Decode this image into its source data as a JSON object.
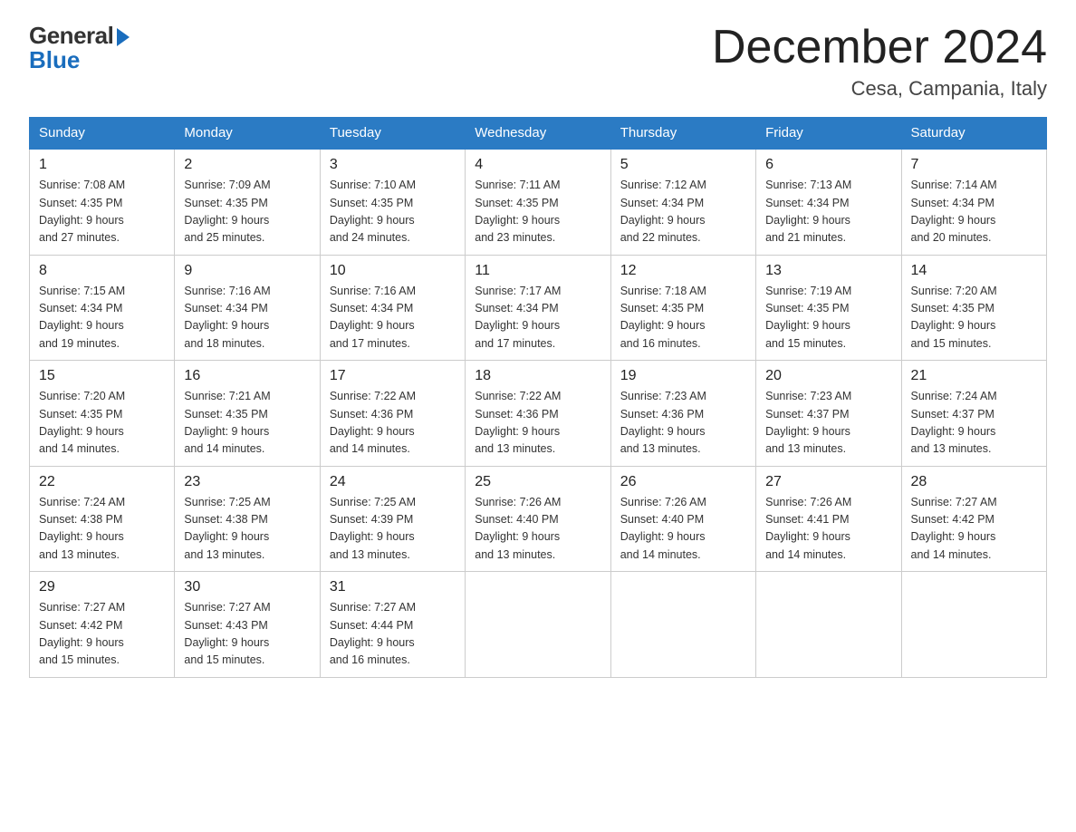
{
  "header": {
    "logo_general": "General",
    "logo_blue": "Blue",
    "month_title": "December 2024",
    "location": "Cesa, Campania, Italy"
  },
  "days_of_week": [
    "Sunday",
    "Monday",
    "Tuesday",
    "Wednesday",
    "Thursday",
    "Friday",
    "Saturday"
  ],
  "weeks": [
    [
      {
        "day": "1",
        "sunrise": "7:08 AM",
        "sunset": "4:35 PM",
        "daylight": "9 hours and 27 minutes."
      },
      {
        "day": "2",
        "sunrise": "7:09 AM",
        "sunset": "4:35 PM",
        "daylight": "9 hours and 25 minutes."
      },
      {
        "day": "3",
        "sunrise": "7:10 AM",
        "sunset": "4:35 PM",
        "daylight": "9 hours and 24 minutes."
      },
      {
        "day": "4",
        "sunrise": "7:11 AM",
        "sunset": "4:35 PM",
        "daylight": "9 hours and 23 minutes."
      },
      {
        "day": "5",
        "sunrise": "7:12 AM",
        "sunset": "4:34 PM",
        "daylight": "9 hours and 22 minutes."
      },
      {
        "day": "6",
        "sunrise": "7:13 AM",
        "sunset": "4:34 PM",
        "daylight": "9 hours and 21 minutes."
      },
      {
        "day": "7",
        "sunrise": "7:14 AM",
        "sunset": "4:34 PM",
        "daylight": "9 hours and 20 minutes."
      }
    ],
    [
      {
        "day": "8",
        "sunrise": "7:15 AM",
        "sunset": "4:34 PM",
        "daylight": "9 hours and 19 minutes."
      },
      {
        "day": "9",
        "sunrise": "7:16 AM",
        "sunset": "4:34 PM",
        "daylight": "9 hours and 18 minutes."
      },
      {
        "day": "10",
        "sunrise": "7:16 AM",
        "sunset": "4:34 PM",
        "daylight": "9 hours and 17 minutes."
      },
      {
        "day": "11",
        "sunrise": "7:17 AM",
        "sunset": "4:34 PM",
        "daylight": "9 hours and 17 minutes."
      },
      {
        "day": "12",
        "sunrise": "7:18 AM",
        "sunset": "4:35 PM",
        "daylight": "9 hours and 16 minutes."
      },
      {
        "day": "13",
        "sunrise": "7:19 AM",
        "sunset": "4:35 PM",
        "daylight": "9 hours and 15 minutes."
      },
      {
        "day": "14",
        "sunrise": "7:20 AM",
        "sunset": "4:35 PM",
        "daylight": "9 hours and 15 minutes."
      }
    ],
    [
      {
        "day": "15",
        "sunrise": "7:20 AM",
        "sunset": "4:35 PM",
        "daylight": "9 hours and 14 minutes."
      },
      {
        "day": "16",
        "sunrise": "7:21 AM",
        "sunset": "4:35 PM",
        "daylight": "9 hours and 14 minutes."
      },
      {
        "day": "17",
        "sunrise": "7:22 AM",
        "sunset": "4:36 PM",
        "daylight": "9 hours and 14 minutes."
      },
      {
        "day": "18",
        "sunrise": "7:22 AM",
        "sunset": "4:36 PM",
        "daylight": "9 hours and 13 minutes."
      },
      {
        "day": "19",
        "sunrise": "7:23 AM",
        "sunset": "4:36 PM",
        "daylight": "9 hours and 13 minutes."
      },
      {
        "day": "20",
        "sunrise": "7:23 AM",
        "sunset": "4:37 PM",
        "daylight": "9 hours and 13 minutes."
      },
      {
        "day": "21",
        "sunrise": "7:24 AM",
        "sunset": "4:37 PM",
        "daylight": "9 hours and 13 minutes."
      }
    ],
    [
      {
        "day": "22",
        "sunrise": "7:24 AM",
        "sunset": "4:38 PM",
        "daylight": "9 hours and 13 minutes."
      },
      {
        "day": "23",
        "sunrise": "7:25 AM",
        "sunset": "4:38 PM",
        "daylight": "9 hours and 13 minutes."
      },
      {
        "day": "24",
        "sunrise": "7:25 AM",
        "sunset": "4:39 PM",
        "daylight": "9 hours and 13 minutes."
      },
      {
        "day": "25",
        "sunrise": "7:26 AM",
        "sunset": "4:40 PM",
        "daylight": "9 hours and 13 minutes."
      },
      {
        "day": "26",
        "sunrise": "7:26 AM",
        "sunset": "4:40 PM",
        "daylight": "9 hours and 14 minutes."
      },
      {
        "day": "27",
        "sunrise": "7:26 AM",
        "sunset": "4:41 PM",
        "daylight": "9 hours and 14 minutes."
      },
      {
        "day": "28",
        "sunrise": "7:27 AM",
        "sunset": "4:42 PM",
        "daylight": "9 hours and 14 minutes."
      }
    ],
    [
      {
        "day": "29",
        "sunrise": "7:27 AM",
        "sunset": "4:42 PM",
        "daylight": "9 hours and 15 minutes."
      },
      {
        "day": "30",
        "sunrise": "7:27 AM",
        "sunset": "4:43 PM",
        "daylight": "9 hours and 15 minutes."
      },
      {
        "day": "31",
        "sunrise": "7:27 AM",
        "sunset": "4:44 PM",
        "daylight": "9 hours and 16 minutes."
      },
      null,
      null,
      null,
      null
    ]
  ],
  "labels": {
    "sunrise": "Sunrise:",
    "sunset": "Sunset:",
    "daylight": "Daylight:"
  }
}
